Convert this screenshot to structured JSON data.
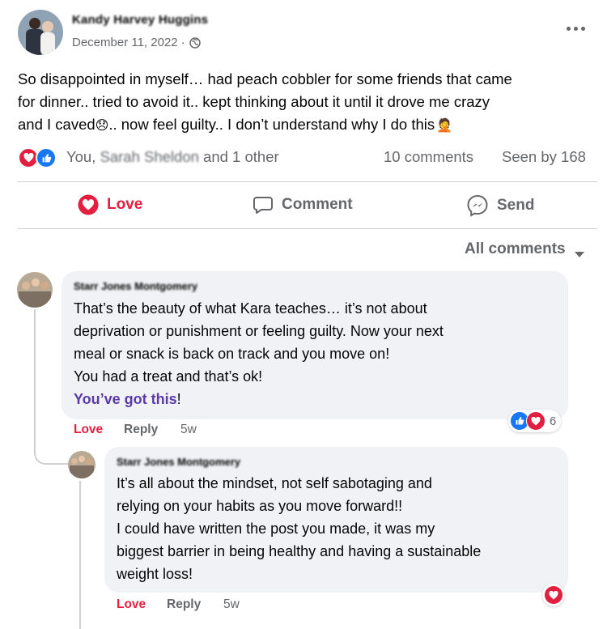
{
  "post": {
    "author": "Kandy Harvey Huggins",
    "date": "December 11, 2022 ·",
    "privacy_icon": "globe-icon",
    "more_icon": "more-dots-icon",
    "text_line1": "So disappointed in myself… had peach cobbler for some friends that came",
    "text_line2": "for dinner.. tried to avoid it.. kept thinking about it until it drove me crazy",
    "text_line3a": "and I caved",
    "text_line3b": ".. now feel guilty.. I don’t understand why I do this",
    "emoji_disappointed": "😞",
    "emoji_person": "🤦"
  },
  "reactions": {
    "you": "You,",
    "friend": "Sarah Sheldon",
    "others": "and 1 other",
    "comments": "10 comments",
    "seen": "Seen by 168"
  },
  "actions": {
    "love": "Love",
    "comment": "Comment",
    "send": "Send"
  },
  "filter": {
    "label": "All comments"
  },
  "comments": [
    {
      "author": "Starr Jones Montgomery",
      "line1": "That’s the beauty of what Kara teaches… it’s not about",
      "line2": "deprivation or punishment or feeling guilty. Now your next",
      "line3": "meal or snack is back on track and you move on!",
      "line4": "You had a treat and that’s ok!",
      "mention": "You’ve got this",
      "after_mention": "!",
      "love": "Love",
      "reply": "Reply",
      "time": "5w",
      "reaction_count": "6"
    },
    {
      "author": "Starr Jones Montgomery",
      "line1": "It’s all about the mindset, not self sabotaging and",
      "line2": "relying on your habits as you move forward!!",
      "line3": "I could have written the post you made, it was my",
      "line4": "biggest barrier in being healthy and having a sustainable",
      "line5": "weight loss!",
      "love": "Love",
      "reply": "Reply",
      "time": "5w"
    }
  ],
  "colors": {
    "love_red": "#e41e3f",
    "like_blue": "#1877f2",
    "mention_purple": "#5b3aa8",
    "bubble_bg": "#f0f2f5"
  }
}
